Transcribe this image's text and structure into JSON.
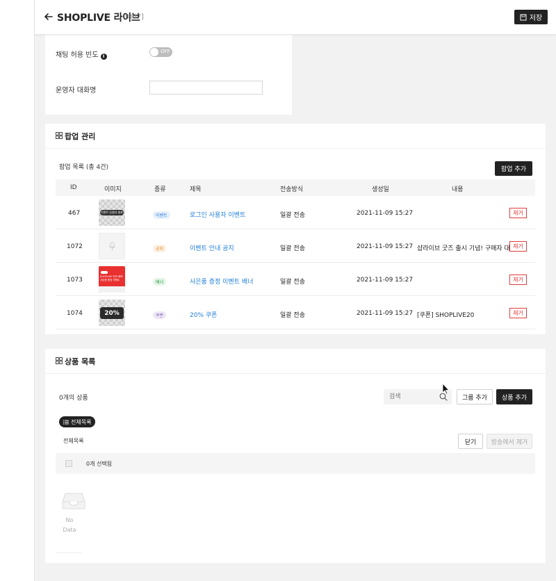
{
  "header": {
    "title": "SHOPLIVE 라이브",
    "count": "[807]",
    "save_label": "저장"
  },
  "settings": {
    "chat_freq_label": "채팅 허용 빈도",
    "toggle_text": "OFF",
    "operator_label": "운영자 대화명",
    "operator_value": ""
  },
  "popup": {
    "section_title": "팝업 관리",
    "list_title": "팝업 목록 (총 4건)",
    "add_label": "팝업 추가",
    "columns": {
      "id": "ID",
      "image": "이미지",
      "type": "종류",
      "title": "제목",
      "method": "전송방식",
      "created": "생성일",
      "content": "내용"
    },
    "rows": [
      {
        "id": "467",
        "type": "이벤트",
        "title": "로그인 사용자 이벤트",
        "method": "일괄 전송",
        "created": "2021-11-09 15:27",
        "content": "",
        "remove": "제거",
        "thumb_text": "이벤트 당첨자 발표"
      },
      {
        "id": "1072",
        "type": "공지",
        "title": "이벤트 안내 공지",
        "method": "일괄 전송",
        "created": "2021-11-09 15:27",
        "content": "샵라이브 굿즈 출시 기념! 구매자 대",
        "remove": "제거",
        "thumb_text": ""
      },
      {
        "id": "1073",
        "type": "배너",
        "title": "사은품 증정 이벤트 배너",
        "method": "일괄 전송",
        "created": "2021-11-09 15:27",
        "content": "",
        "remove": "제거",
        "thumb_text": "SHOPLIVE 단독 혜택 사은품 증정 이벤트"
      },
      {
        "id": "1074",
        "type": "쿠폰",
        "title": "20% 쿠폰",
        "method": "일괄 전송",
        "created": "2021-11-09 15:27",
        "content": "[쿠폰] SHOPLIVE20",
        "remove": "제거",
        "thumb_text": "20%"
      }
    ],
    "badge_colors": {
      "event": "#2f7fd8",
      "notice": "#e0882b",
      "banner": "#2e9a4a",
      "coupon": "#7a5bb5"
    }
  },
  "products": {
    "section_title": "상품 목록",
    "count_text": "0개의 상품",
    "search_placeholder": "검색",
    "group_add_label": "그룹 추가",
    "product_add_label": "상품 추가",
    "pill_label": "전체목록",
    "all_list_label": "전체목록",
    "close_label": "닫기",
    "remove_from_broadcast_label": "방송에서 제거",
    "selected_text": "0개 선택됨",
    "no_data": "No Data"
  }
}
